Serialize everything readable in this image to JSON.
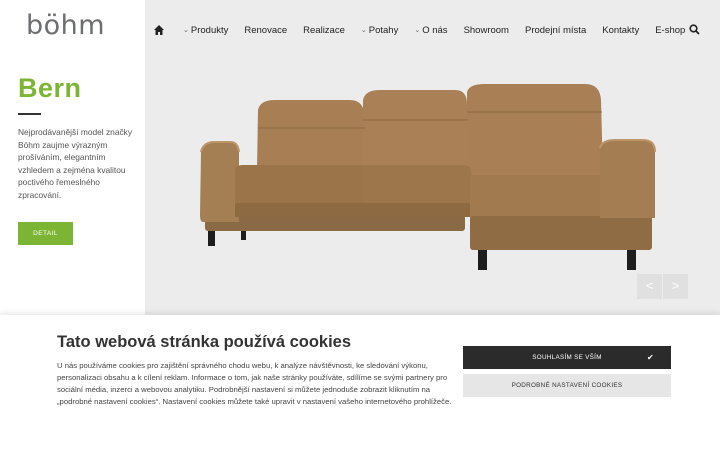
{
  "brand": {
    "logo_text": "böhm",
    "accent_color": "#7cb534"
  },
  "nav": {
    "home_icon": "home-icon",
    "items": [
      {
        "label": "Produkty",
        "has_dropdown": true
      },
      {
        "label": "Renovace",
        "has_dropdown": false
      },
      {
        "label": "Realizace",
        "has_dropdown": false
      },
      {
        "label": "Potahy",
        "has_dropdown": true
      },
      {
        "label": "O nás",
        "has_dropdown": true
      },
      {
        "label": "Showroom",
        "has_dropdown": false
      },
      {
        "label": "Prodejní místa",
        "has_dropdown": false
      },
      {
        "label": "Kontakty",
        "has_dropdown": false
      },
      {
        "label": "E-shop",
        "has_dropdown": false
      }
    ],
    "search_icon": "search-icon"
  },
  "hero": {
    "title": "Bern",
    "description": "Nejprodávanější model značky Böhm zaujme výrazným prošíváním, elegantním vzhledem a zejména kvalitou poctivého řemeslného zpracování.",
    "detail_button": "DETAIL",
    "image": "brown leather corner sofa with chaise",
    "prev_arrow": "<",
    "next_arrow": ">"
  },
  "cookie": {
    "title": "Tato webová stránka používá cookies",
    "text": "U nás používáme cookies pro zajištění správného chodu webu, k analýze návštěvnosti, ke sledování výkonu, personalizaci obsahu a k cílení reklam. Informace o tom, jak naše stránky používáte, sdílíme se svými partnery pro sociální média, inzerci a webovou analytiku. Podrobnější nastavení si můžete jednoduše zobrazit kliknutím na „podrobné nastavení cookies“. Nastavení cookies můžete také upravit v nastavení vašeho internetového prohlížeče.",
    "accept_label": "SOUHLASÍM SE VŠÍM",
    "settings_label": "PODROBNÉ NASTAVENÍ COOKIES"
  }
}
